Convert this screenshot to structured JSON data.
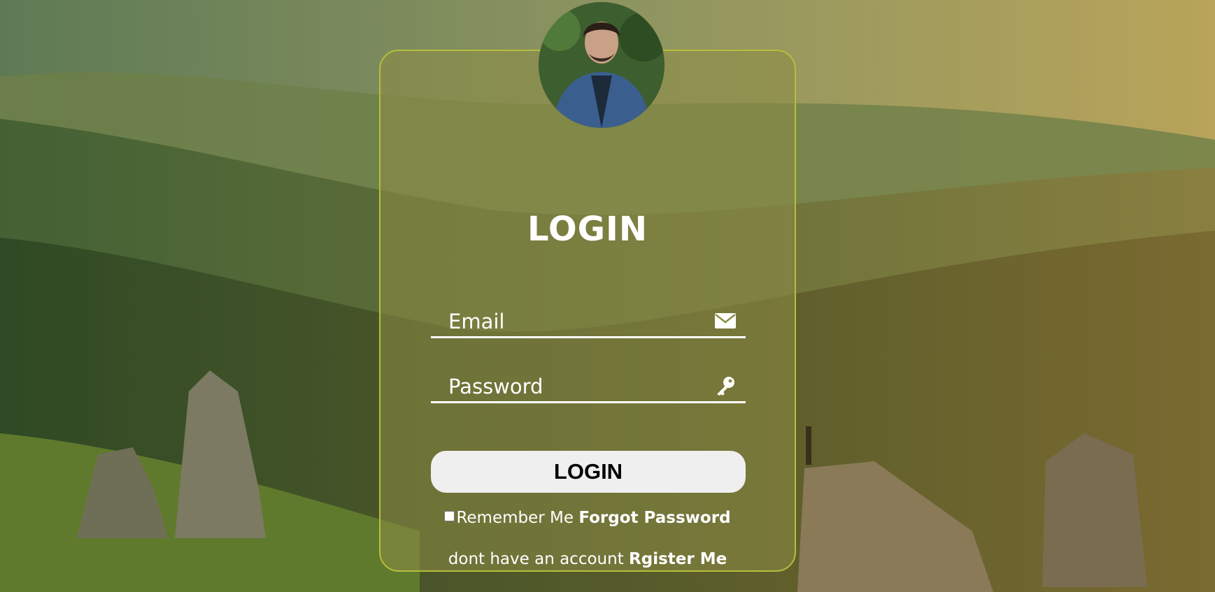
{
  "login": {
    "title": "LOGIN",
    "email_placeholder": "Email",
    "password_placeholder": "Password",
    "button_label": "LOGIN",
    "remember_label": "Remember Me",
    "forgot_label": "Forgot Password",
    "register_prompt": "dont have an account",
    "register_label": "Rgister Me"
  },
  "icons": {
    "email": "envelope-icon",
    "password": "key-icon"
  },
  "colors": {
    "card_border": "#b7be3c",
    "text": "#ffffff",
    "button_bg": "#efefef"
  }
}
